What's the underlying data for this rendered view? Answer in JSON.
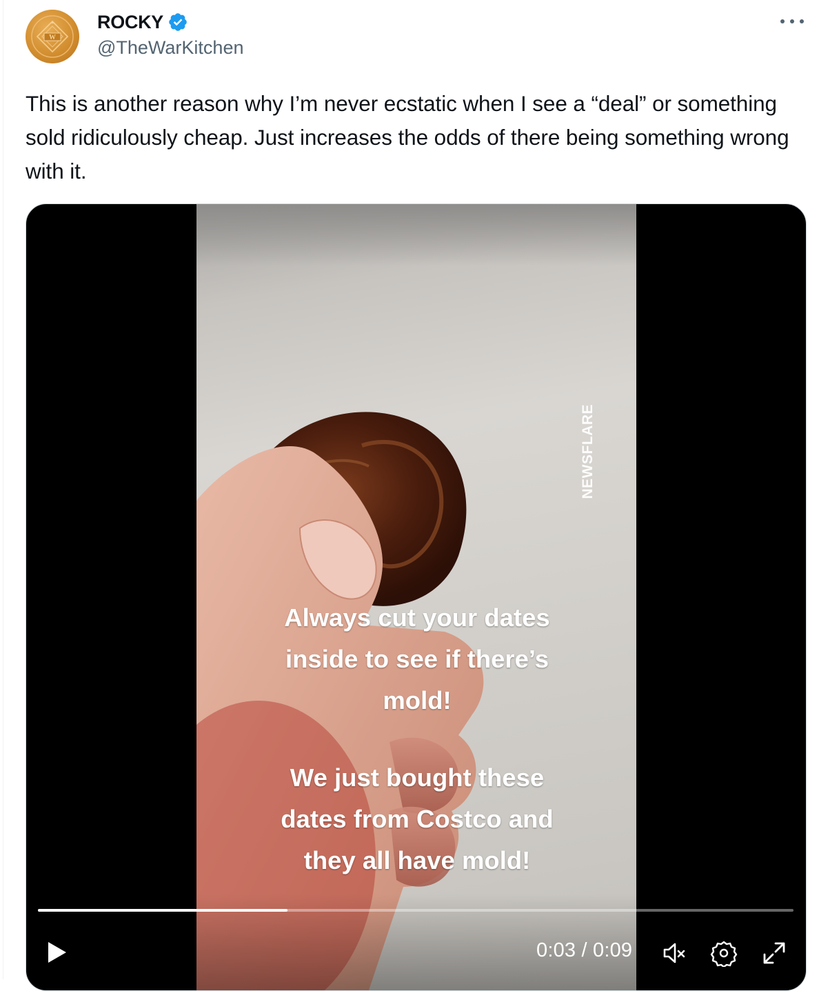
{
  "author": {
    "display_name": "ROCKY",
    "handle": "@TheWarKitchen",
    "verified": true,
    "avatar_icon": "war-kitchen-logo-icon",
    "avatar_color": "#d08b2c"
  },
  "more_icon": "more-horizontal-icon",
  "tweet": {
    "text": "This is another reason why I’m never ecstatic when I see a “deal” or something sold ridiculously cheap. Just increases the odds of there being something wrong with it."
  },
  "video": {
    "watermark": "NEWSFLARE",
    "caption_1": "Always cut your dates\ninside to see if there’s\nmold!",
    "caption_2": "We just bought these\ndates from Costco and\nthey all have mold!",
    "progress_fraction": 0.33,
    "time_display": "0:03 / 0:09",
    "controls": {
      "play_icon": "play-icon",
      "mute_icon": "muted-speaker-icon",
      "settings_icon": "gear-icon",
      "fullscreen_icon": "expand-icon"
    }
  },
  "colors": {
    "verified_blue": "#1d9bf0",
    "secondary_text": "#536471",
    "border": "#cfd9de"
  }
}
